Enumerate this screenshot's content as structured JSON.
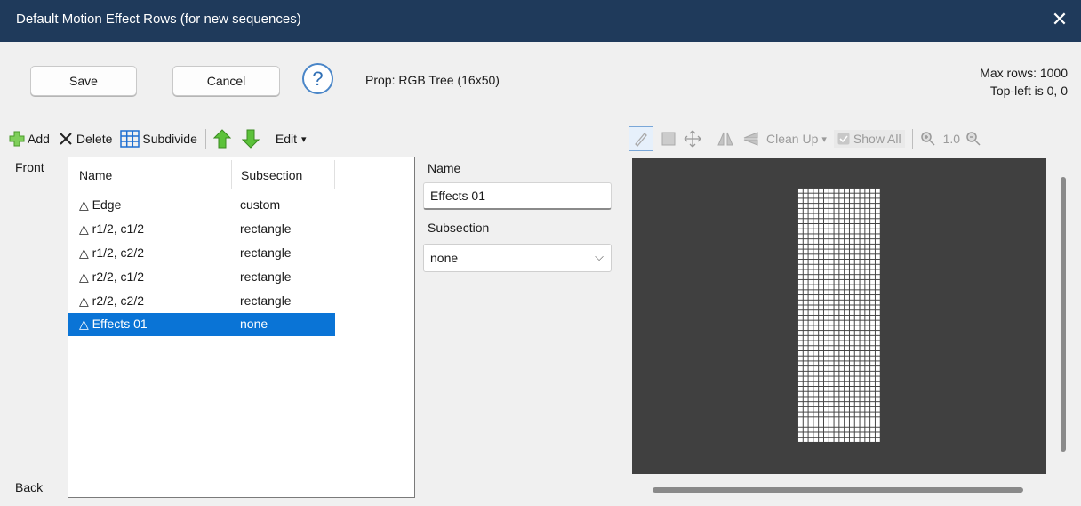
{
  "window": {
    "title": "Default Motion Effect Rows (for new sequences)",
    "close_glyph": "✕"
  },
  "buttons": {
    "save": "Save",
    "cancel": "Cancel",
    "help": "?"
  },
  "prop_label": "Prop: RGB Tree (16x50)",
  "info": {
    "max_rows": "Max rows: 1000",
    "top_left": "Top-left is 0, 0"
  },
  "toolbar": {
    "add": "Add",
    "delete": "Delete",
    "subdivide": "Subdivide",
    "edit": "Edit",
    "edit_caret": "▾"
  },
  "list": {
    "front_label": "Front",
    "back_label": "Back",
    "headers": {
      "name": "Name",
      "subsection": "Subsection"
    },
    "rows": [
      {
        "name": "△ Edge",
        "subsection": "custom",
        "selected": false
      },
      {
        "name": "△ r1/2, c1/2",
        "subsection": "rectangle",
        "selected": false
      },
      {
        "name": "△ r1/2, c2/2",
        "subsection": "rectangle",
        "selected": false
      },
      {
        "name": "△ r2/2, c1/2",
        "subsection": "rectangle",
        "selected": false
      },
      {
        "name": "△ r2/2, c2/2",
        "subsection": "rectangle",
        "selected": false
      },
      {
        "name": "△ Effects 01",
        "subsection": "none",
        "selected": true
      }
    ]
  },
  "detail": {
    "name_label": "Name",
    "name_value": "Effects 01",
    "subsection_label": "Subsection",
    "subsection_value": "none",
    "chevron_glyph": "⌵"
  },
  "right_toolbar": {
    "clean_up": "Clean Up",
    "clean_up_caret": "▾",
    "show_all": "Show All",
    "zoom": "1.0"
  },
  "colors": {
    "titlebar": "#1f3a5b",
    "selection": "#0a74d6",
    "canvas_bg": "#404040",
    "grid_pixels": "#ffffff",
    "add_icon": "#5fb93a",
    "arrow_icons": "#4caf2e",
    "subdivide_icon": "#1f6fd1"
  },
  "icons": {
    "add": "plus-icon",
    "delete": "x-icon",
    "subdivide": "grid-icon",
    "move_up": "arrow-up-icon",
    "move_down": "arrow-down-icon",
    "pencil": "pencil-icon",
    "rect": "rectangle-icon",
    "move": "move-icon",
    "flip_h": "flip-horizontal-icon",
    "flip_v": "flip-vertical-icon",
    "zoom_in": "zoom-in-icon",
    "zoom_out": "zoom-out-icon"
  }
}
